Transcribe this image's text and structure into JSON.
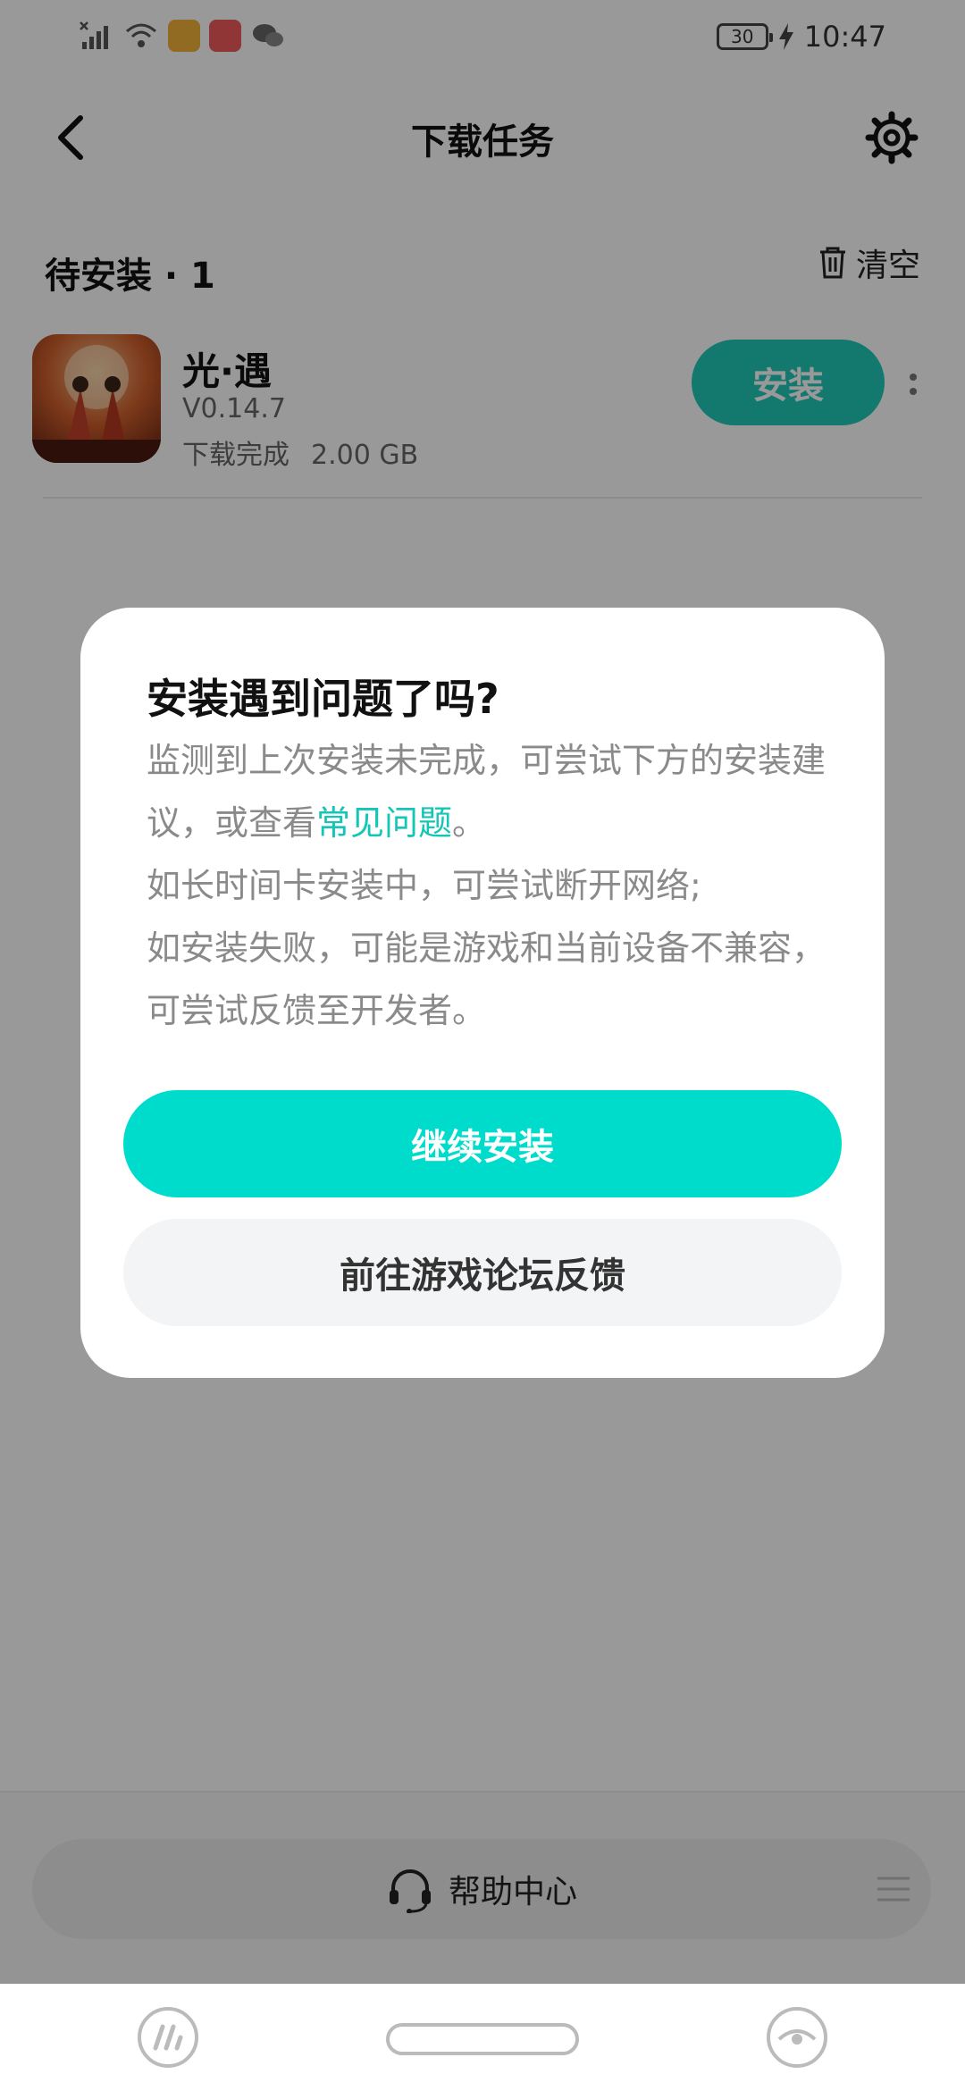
{
  "status_bar": {
    "battery_level": "30",
    "time": "10:47",
    "app_badges": [
      {
        "name": "app-badge-1",
        "color": "#f2b23a"
      },
      {
        "name": "app-badge-huawei",
        "color": "#f05a5a"
      }
    ]
  },
  "header": {
    "title": "下载任务"
  },
  "section": {
    "title": "待安装 · 1",
    "clear_label": "清空"
  },
  "task": {
    "name": "光·遇",
    "version": "V0.14.7",
    "status": "下载完成",
    "size": "2.00 GB",
    "install_label": "安装"
  },
  "dialog": {
    "title": "安装遇到问题了吗?",
    "body_part1": "监测到上次安装未完成，可尝试下方的安装建议，或查看",
    "link": "常见问题",
    "body_part1_end": "。",
    "line2": "如长时间卡安装中，可尝试断开网络;",
    "line3": "如安装失败，可能是游戏和当前设备不兼容，可尝试反馈至开发者。",
    "primary_button": "继续安装",
    "secondary_button": "前往游戏论坛反馈"
  },
  "help_bar": {
    "label": "帮助中心"
  },
  "colors": {
    "accent": "#00dccc",
    "install_button": "#20c8b8",
    "link": "#14c6b6"
  }
}
